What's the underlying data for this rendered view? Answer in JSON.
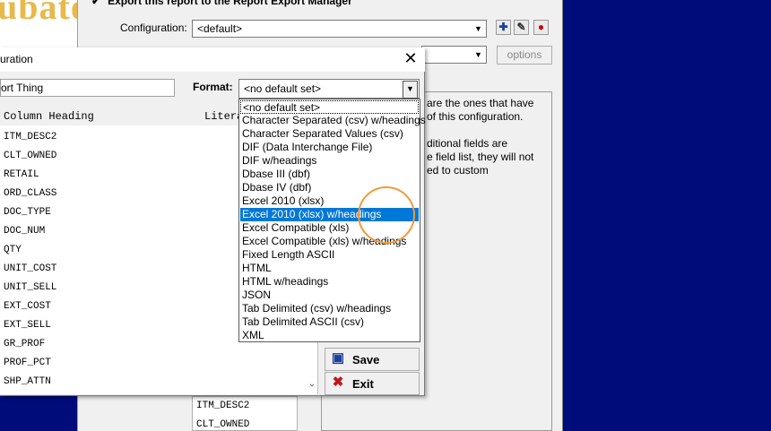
{
  "logo": {
    "text": "ubato"
  },
  "background_window": {
    "export_checkbox_label": "Export this report to the Report Export Manager",
    "configuration_label": "Configuration:",
    "configuration_value": "<default>",
    "options_button": "options",
    "help_text_lines": [
      "are the ones that have",
      "of this configuration.",
      "",
      "ditional fields are",
      "e field list, they will not",
      "ed to custom"
    ],
    "bottom_list": [
      "ITM_DESC2",
      "CLT_OWNED"
    ]
  },
  "dialog": {
    "title": "uration",
    "close_glyph": "✕",
    "name_value": "ort Thing",
    "format_label": "Format:",
    "format_value": "<no default set>",
    "columns": {
      "heading": "Column Heading",
      "literal": "Litera"
    },
    "rows": [
      "ITM_DESC2",
      "CLT_OWNED",
      "RETAIL",
      "ORD_CLASS",
      "DOC_TYPE",
      "DOC_NUM",
      "QTY",
      "UNIT_COST",
      "UNIT_SELL",
      "EXT_COST",
      "EXT_SELL",
      "GR_PROF",
      "PROF_PCT",
      "SHP_ATTN"
    ],
    "save_button": "Save",
    "exit_button": "Exit"
  },
  "dropdown": {
    "items": [
      "<no default set>",
      "Character Separated (csv) w/headings",
      "Character Separated Values (csv)",
      "DIF (Data Interchange File)",
      "DIF w/headings",
      "Dbase III (dbf)",
      "Dbase IV (dbf)",
      "Excel 2010 (xlsx)",
      "Excel 2010 (xlsx) w/headings",
      "Excel Compatible (xls)",
      "Excel Compatible (xls) w/headings",
      "Fixed Length ASCII",
      "HTML",
      "HTML w/headings",
      "JSON",
      "Tab Delimited (csv) w/headings",
      "Tab Delimited ASCII (csv)",
      "XML"
    ],
    "selected_index": 8
  },
  "colors": {
    "desktop": "#000c7a",
    "selection": "#0078d7",
    "cursor_ring": "#f29a3d",
    "logo": "#e9b84a"
  }
}
